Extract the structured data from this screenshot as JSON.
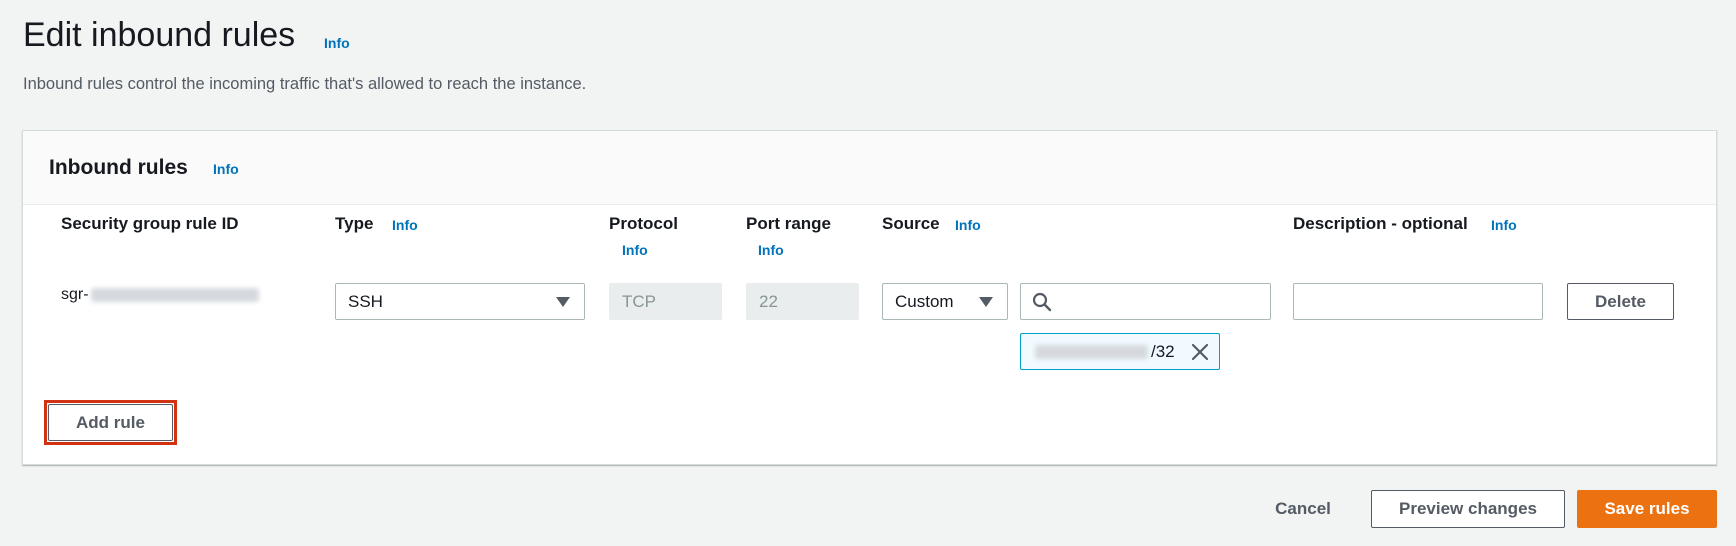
{
  "header": {
    "title": "Edit inbound rules",
    "info_label": "Info",
    "description": "Inbound rules control the incoming traffic that's allowed to reach the instance."
  },
  "panel": {
    "title": "Inbound rules",
    "info_label": "Info",
    "columns": {
      "rule_id": "Security group rule ID",
      "type": "Type",
      "protocol": "Protocol",
      "port_range": "Port range",
      "source": "Source",
      "description": "Description - optional"
    },
    "info_label_columns": "Info",
    "rule": {
      "rule_id_prefix": "sgr-",
      "type": "SSH",
      "protocol": "TCP",
      "port_range": "22",
      "source_type": "Custom",
      "search_placeholder": "",
      "cidr_suffix": "/32",
      "description_value": "",
      "delete_label": "Delete"
    },
    "add_rule_label": "Add rule"
  },
  "footer": {
    "cancel_label": "Cancel",
    "preview_label": "Preview changes",
    "save_label": "Save rules"
  },
  "colors": {
    "accent": "#ec7211",
    "link": "#0073bb",
    "highlight": "#d13212",
    "token_border": "#00a1c9",
    "token_bg": "#f1faff"
  }
}
